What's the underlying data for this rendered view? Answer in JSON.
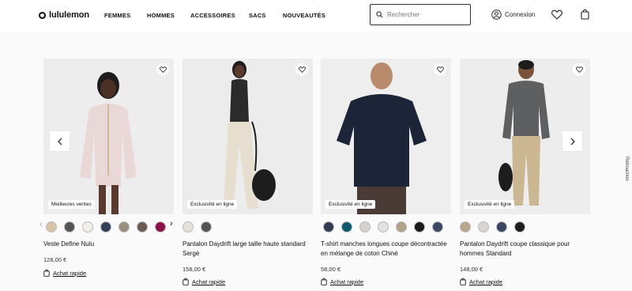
{
  "header": {
    "brand": "lululemon",
    "nav": [
      "FEMMES",
      "HOMMES",
      "ACCESSOIRES",
      "SACS",
      "NOUVEAUTÉS"
    ],
    "search_placeholder": "Rechercher",
    "account_label": "Connexion"
  },
  "products": [
    {
      "name": "Veste Define Nulu",
      "price": "128,00 €",
      "badge": "Meilleures ventes",
      "quick_label": "Achat rapide",
      "swatches": [
        "#d9c3a7",
        "#555555",
        "#f2efe8",
        "#334158",
        "#9b8f80",
        "#6b5b52",
        "#8c1148"
      ]
    },
    {
      "name": "Pantalon Daydrift large taille haute standard Sergé",
      "price": "158,00 €",
      "badge": "Exclusivité en ligne",
      "quick_label": "Achat rapide",
      "swatches": [
        "#e4e1d9",
        "#555555"
      ]
    },
    {
      "name": "T-shirt manches longues coupe décontractée en mélange de coton Chiné",
      "price": "58,00 €",
      "badge": "Exclusivité en ligne",
      "quick_label": "Achat rapide",
      "swatches": [
        "#2f3c52",
        "#0f5b6e",
        "#d6d2cb",
        "#e2e2e2",
        "#b4a386",
        "#1b1b1b",
        "#3c4966"
      ]
    },
    {
      "name": "Pantalon Daydrift coupe classique pour hommes Standard",
      "price": "148,00 €",
      "badge": "Exclusivité en ligne",
      "quick_label": "Achat rapide",
      "swatches": [
        "#b8a68a",
        "#d9d6d0",
        "#3a4660",
        "#1d1d1d"
      ]
    }
  ],
  "feedback_label": "Rétroaction"
}
